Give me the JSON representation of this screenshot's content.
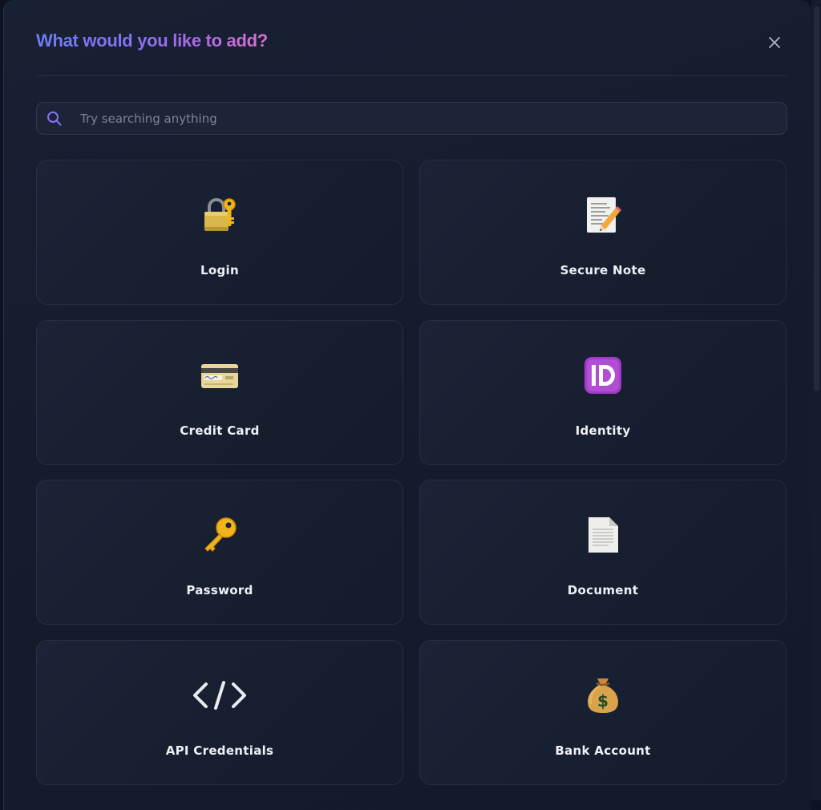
{
  "dialog": {
    "title": "What would you like to add?",
    "close_label": "Close"
  },
  "search": {
    "placeholder": "Try searching anything",
    "value": ""
  },
  "items": [
    {
      "label": "Login",
      "icon": "lock-with-key-icon"
    },
    {
      "label": "Secure Note",
      "icon": "memo-icon"
    },
    {
      "label": "Credit Card",
      "icon": "credit-card-icon"
    },
    {
      "label": "Identity",
      "icon": "id-badge-icon"
    },
    {
      "label": "Password",
      "icon": "key-icon"
    },
    {
      "label": "Document",
      "icon": "document-icon"
    },
    {
      "label": "API Credentials",
      "icon": "code-brackets-icon"
    },
    {
      "label": "Bank Account",
      "icon": "money-bag-icon"
    }
  ],
  "colors": {
    "background": "#0d1322",
    "card_background": "#1a2234",
    "card_border": "#263044",
    "title_gradient_start": "#6d7df7",
    "title_gradient_end": "#d772c8",
    "search_icon": "#8a6ff0"
  }
}
